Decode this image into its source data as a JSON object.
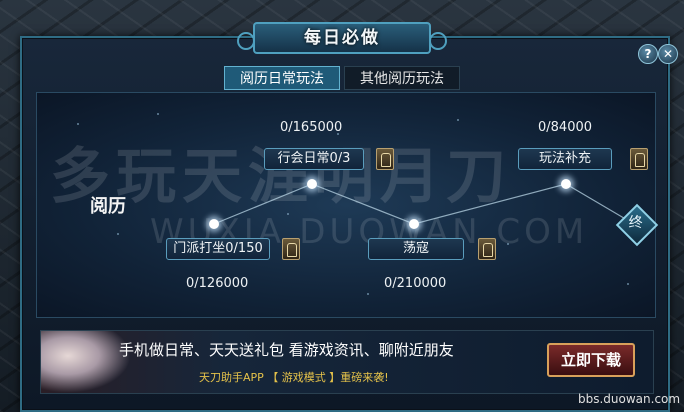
{
  "window": {
    "title": "每日必做",
    "help_label": "?",
    "close_label": "✕"
  },
  "tabs": [
    {
      "label": "阅历日常玩法",
      "active": true
    },
    {
      "label": "其他阅历玩法",
      "active": false
    }
  ],
  "tree": {
    "root_label": "阅历",
    "nodes": [
      {
        "label": "行会日常0/3",
        "progress": "0/165000"
      },
      {
        "label": "玩法补充",
        "progress": "0/84000"
      },
      {
        "label": "门派打坐0/150",
        "progress": "0/126000"
      },
      {
        "label": "荡寇",
        "progress": "0/210000"
      }
    ],
    "end_icon": "finish-emblem-icon"
  },
  "watermark": {
    "text": "多玩天涯明月刀",
    "url": "WUXIA.DUOWAN.COM"
  },
  "banner": {
    "headline": "手机做日常、天天送礼包  看游戏资讯、聊附近朋友",
    "subline": "天刀助手APP 【 游戏模式 】重磅来袭!",
    "button_label": "立即下载"
  },
  "footer": {
    "site": "bbs.duowan.com"
  },
  "colors": {
    "accent": "#4fa0bf",
    "banner_gold": "#e5c24a"
  }
}
